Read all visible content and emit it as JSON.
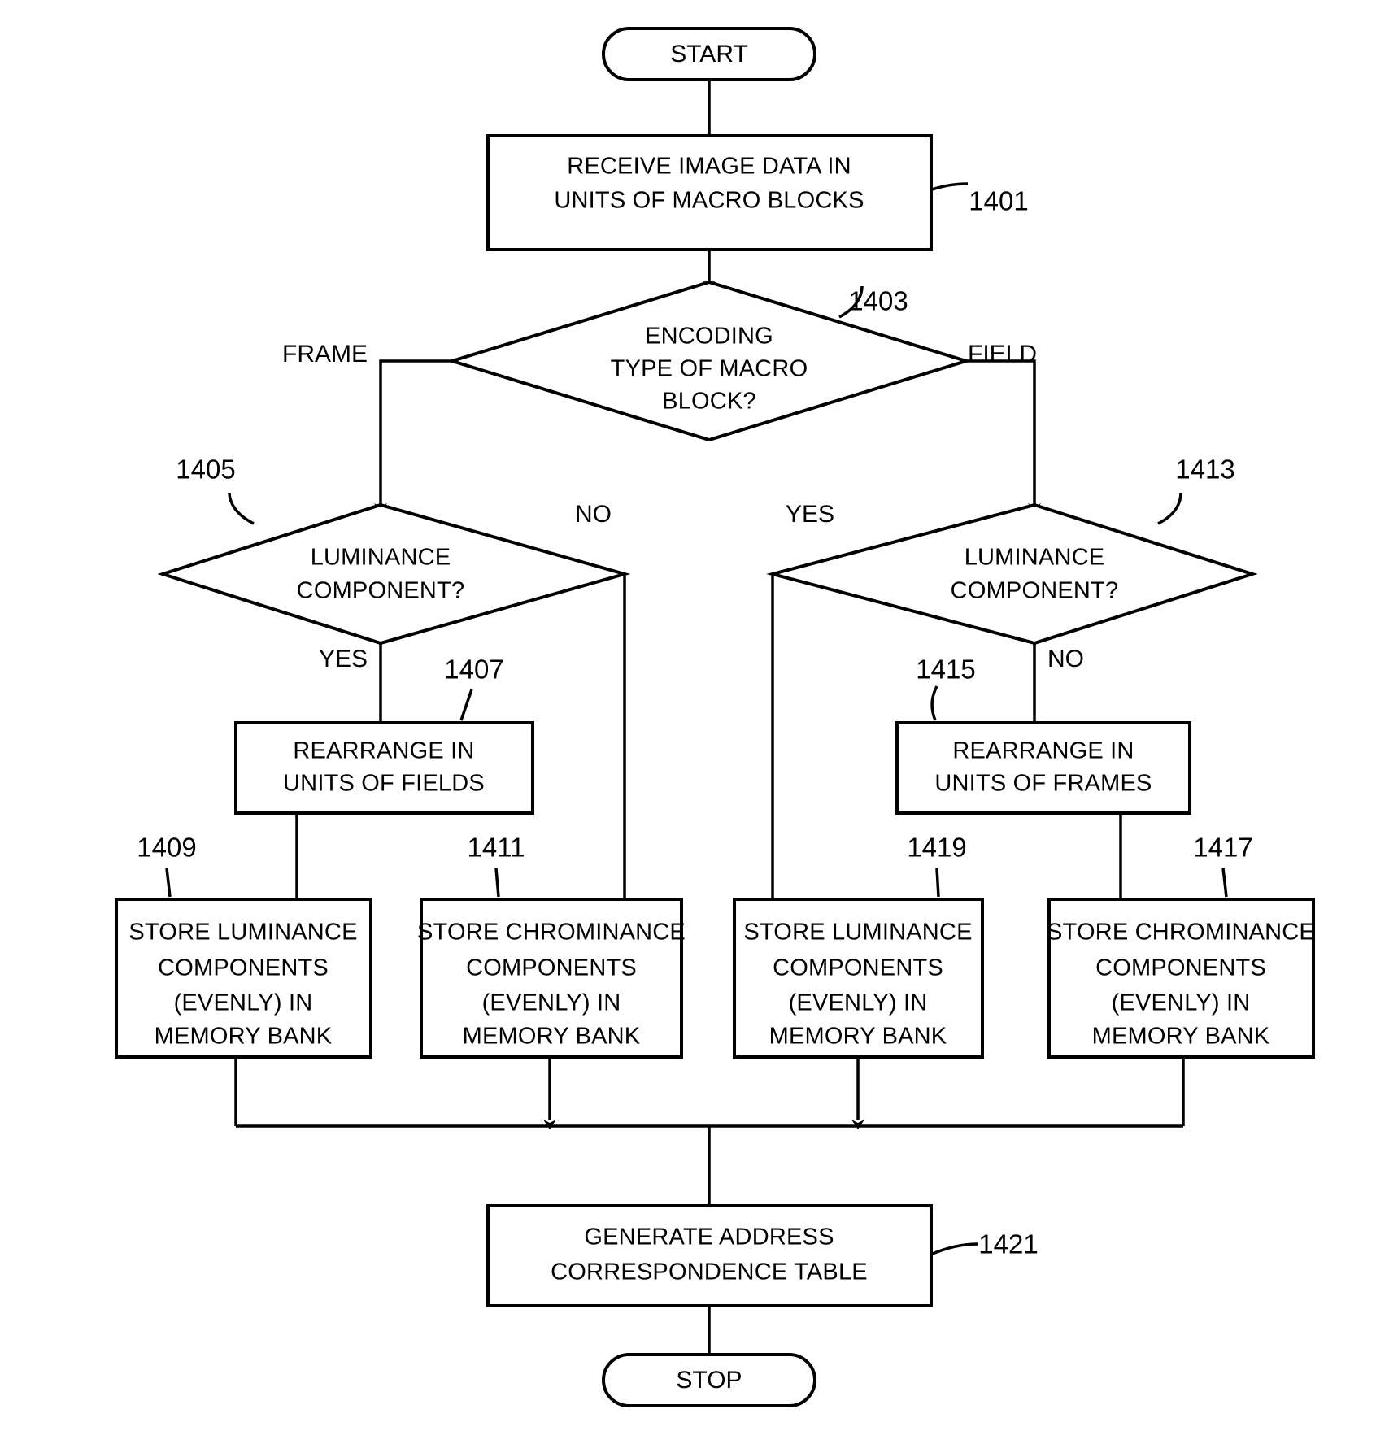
{
  "figure": {
    "type": "flowchart",
    "orientation": "top-to-bottom"
  },
  "nodes": {
    "start": {
      "label": "START",
      "shape": "terminator"
    },
    "stop": {
      "label": "STOP",
      "shape": "terminator"
    },
    "receive": {
      "ref": "1401",
      "shape": "process",
      "line1": "RECEIVE IMAGE DATA IN",
      "line2": "UNITS OF MACRO BLOCKS"
    },
    "encoding_type": {
      "ref": "1403",
      "shape": "decision",
      "line1": "ENCODING",
      "line2": "TYPE OF MACRO",
      "line3": "BLOCK?"
    },
    "lum_left": {
      "ref": "1405",
      "shape": "decision",
      "line1": "LUMINANCE",
      "line2": "COMPONENT?"
    },
    "lum_right": {
      "ref": "1413",
      "shape": "decision",
      "line1": "LUMINANCE",
      "line2": "COMPONENT?"
    },
    "rearrange_fields": {
      "ref": "1407",
      "shape": "process",
      "line1": "REARRANGE IN",
      "line2": "UNITS OF FIELDS"
    },
    "rearrange_frames": {
      "ref": "1415",
      "shape": "process",
      "line1": "REARRANGE IN",
      "line2": "UNITS OF FRAMES"
    },
    "store_lum_1409": {
      "ref": "1409",
      "shape": "process",
      "line1": "STORE LUMINANCE",
      "line2": "COMPONENTS",
      "line3": "(EVENLY) IN",
      "line4": "MEMORY BANK"
    },
    "store_chrom_1411": {
      "ref": "1411",
      "shape": "process",
      "line1": "STORE CHROMINANCE",
      "line2": "COMPONENTS",
      "line3": "(EVENLY)  IN",
      "line4": "MEMORY BANK"
    },
    "store_lum_1419": {
      "ref": "1419",
      "shape": "process",
      "line1": "STORE LUMINANCE",
      "line2": "COMPONENTS",
      "line3": "(EVENLY) IN",
      "line4": "MEMORY BANK"
    },
    "store_chrom_1417": {
      "ref": "1417",
      "shape": "process",
      "line1": "STORE CHROMINANCE",
      "line2": "COMPONENTS",
      "line3": "(EVENLY) IN",
      "line4": "MEMORY BANK"
    },
    "generate_table": {
      "ref": "1421",
      "shape": "process",
      "line1": "GENERATE ADDRESS",
      "line2": "CORRESPONDENCE TABLE"
    }
  },
  "edge_labels": {
    "frame": "FRAME",
    "field": "FIELD",
    "left_yes": "YES",
    "left_no": "NO",
    "right_yes": "YES",
    "right_no": "NO"
  },
  "colors": {
    "stroke": "#000000",
    "fill": "#ffffff",
    "background": "#ffffff"
  }
}
